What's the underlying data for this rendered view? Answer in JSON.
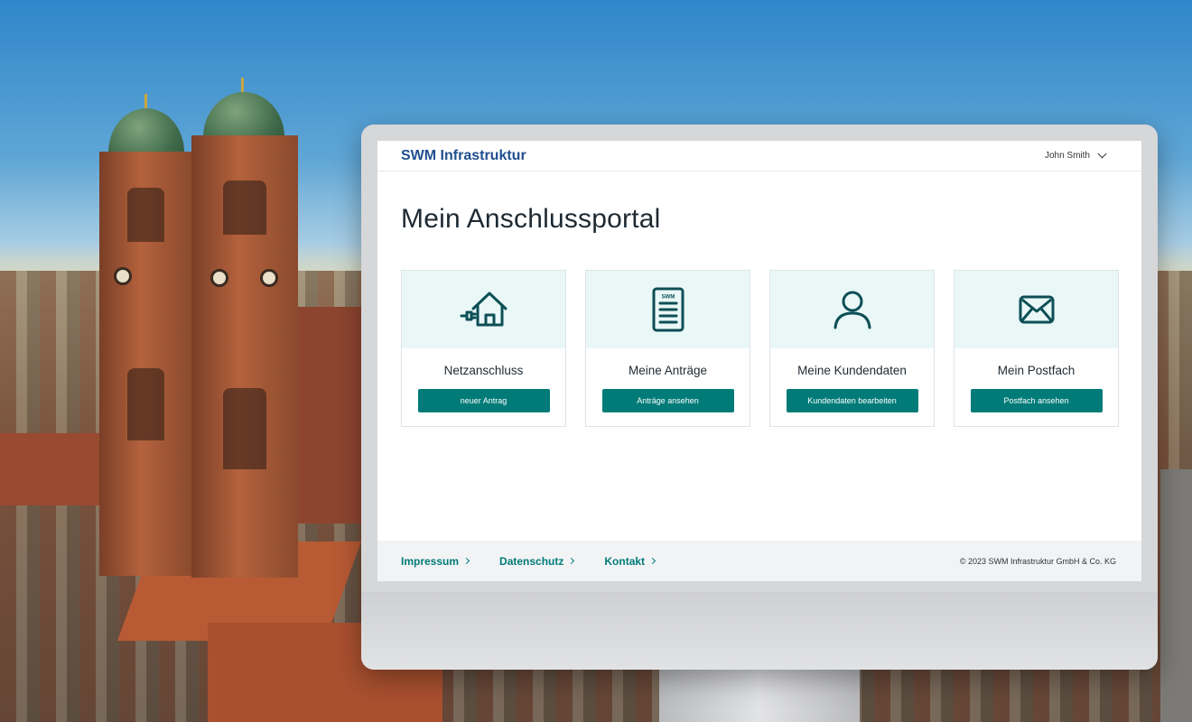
{
  "header": {
    "brand": "SWM Infrastruktur",
    "user_name": "John Smith"
  },
  "main": {
    "title": "Mein Anschlussportal",
    "cards": [
      {
        "icon": "house-plug-icon",
        "title": "Netzanschluss",
        "button": "neuer Antrag"
      },
      {
        "icon": "document-icon",
        "title": "Meine Anträge",
        "button": "Anträge ansehen",
        "icon_label": "SWM"
      },
      {
        "icon": "user-icon",
        "title": "Meine Kundendaten",
        "button": "Kundendaten bearbeiten"
      },
      {
        "icon": "envelope-icon",
        "title": "Mein Postfach",
        "button": "Postfach ansehen"
      }
    ]
  },
  "footer": {
    "links": [
      "Impressum",
      "Datenschutz",
      "Kontakt"
    ],
    "copyright": "© 2023 SWM Infrastruktur GmbH & Co. KG"
  },
  "colors": {
    "brand": "#1f4f8f",
    "accent": "#007b78",
    "card_bg": "#eaf7f7"
  }
}
